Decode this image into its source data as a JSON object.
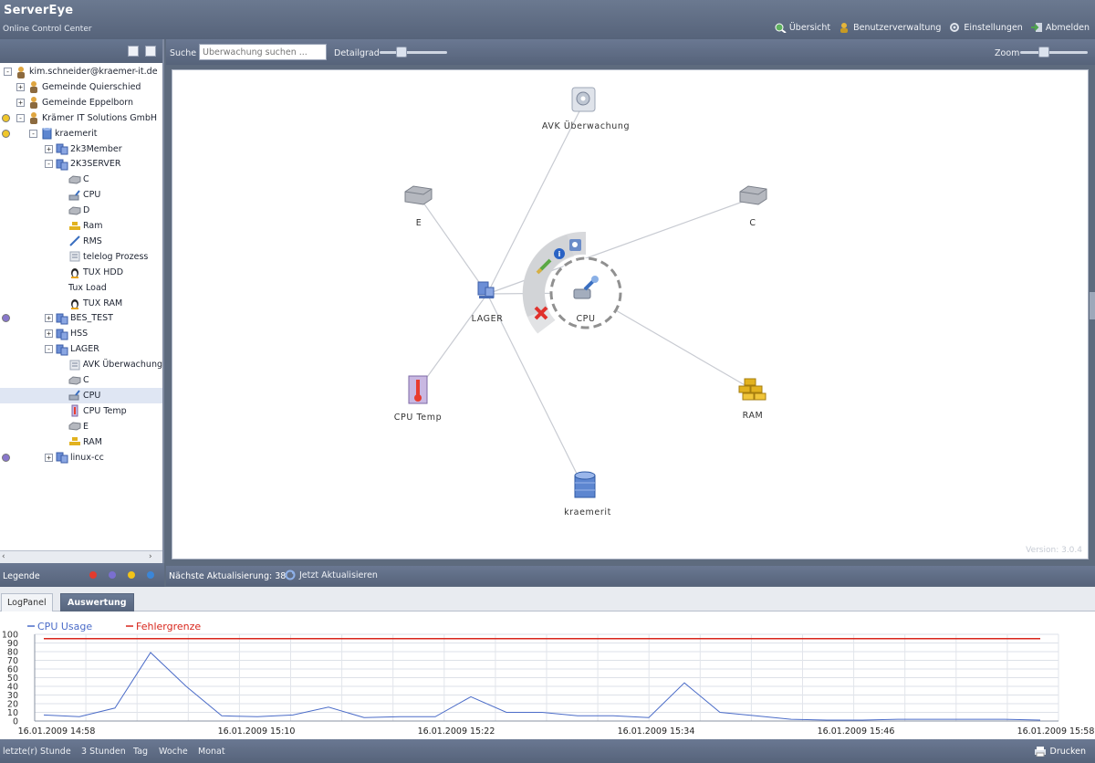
{
  "app": {
    "title": "ServerEye",
    "subtitle": "Online Control Center"
  },
  "top_nav": [
    {
      "label": "Übersicht",
      "icon": "overview-icon"
    },
    {
      "label": "Benutzerverwaltung",
      "icon": "user-management-icon"
    },
    {
      "label": "Einstellungen",
      "icon": "settings-icon"
    },
    {
      "label": "Abmelden",
      "icon": "logout-icon"
    }
  ],
  "tree": {
    "rows": [
      {
        "label": "kim.schneider@kraemer-it.de",
        "icon": "user-icon",
        "expander": "-",
        "indent": 0
      },
      {
        "label": "Gemeinde Quierschied",
        "icon": "user-icon",
        "expander": "+",
        "indent": 1
      },
      {
        "label": "Gemeinde Eppelborn",
        "icon": "user-icon",
        "expander": "+",
        "indent": 1
      },
      {
        "label": "Krämer IT Solutions GmbH",
        "icon": "user-icon",
        "expander": "-",
        "indent": 1,
        "status": "yellow"
      },
      {
        "label": "kraemerit",
        "icon": "database-icon",
        "expander": "-",
        "indent": 2,
        "status": "yellow"
      },
      {
        "label": "2k3Member",
        "icon": "server-group-icon",
        "expander": "+",
        "indent": 3
      },
      {
        "label": "2K3SERVER",
        "icon": "server-group-icon",
        "expander": "-",
        "indent": 3
      },
      {
        "label": "C",
        "icon": "drive-icon",
        "indent": 4
      },
      {
        "label": "CPU",
        "icon": "cpu-icon",
        "indent": 4
      },
      {
        "label": "D",
        "icon": "drive-icon",
        "indent": 4
      },
      {
        "label": "Ram",
        "icon": "ram-icon",
        "indent": 4
      },
      {
        "label": "RMS",
        "icon": "pen-icon",
        "indent": 4
      },
      {
        "label": "telelog Prozess",
        "icon": "process-icon",
        "indent": 4
      },
      {
        "label": "TUX HDD",
        "icon": "tux-icon",
        "indent": 4
      },
      {
        "label": "Tux Load",
        "icon": "none",
        "indent": 4
      },
      {
        "label": "TUX RAM",
        "icon": "tux-icon",
        "indent": 4
      },
      {
        "label": "BES_TEST",
        "icon": "server-group-icon",
        "expander": "+",
        "indent": 3,
        "status": "purple"
      },
      {
        "label": "HSS",
        "icon": "server-group-icon",
        "expander": "+",
        "indent": 3
      },
      {
        "label": "LAGER",
        "icon": "server-group-icon",
        "expander": "-",
        "indent": 3
      },
      {
        "label": "AVK Überwachung",
        "icon": "process-icon",
        "indent": 4
      },
      {
        "label": "C",
        "icon": "drive-icon",
        "indent": 4
      },
      {
        "label": "CPU",
        "icon": "cpu-icon",
        "indent": 4,
        "selected": true
      },
      {
        "label": "CPU Temp",
        "icon": "thermometer-icon",
        "indent": 4
      },
      {
        "label": "E",
        "icon": "drive-icon",
        "indent": 4
      },
      {
        "label": "RAM",
        "icon": "ram-icon",
        "indent": 4
      },
      {
        "label": "linux-cc",
        "icon": "server-group-icon",
        "expander": "+",
        "indent": 3,
        "status": "purple"
      }
    ]
  },
  "legend": {
    "label": "Legende",
    "colors": [
      "#e23b2e",
      "#7a6fd0",
      "#f2c318",
      "#3b86d8"
    ]
  },
  "toolbar": {
    "search_label": "Suche",
    "search_placeholder": "Überwachung suchen ...",
    "detail_label": "Detailgrad",
    "zoom_label": "Zoom"
  },
  "graph": {
    "center": {
      "label": "LAGER"
    },
    "selected": {
      "label": "CPU"
    },
    "nodes": [
      {
        "id": "avk",
        "label": "AVK Überwachung",
        "icon": "process-icon"
      },
      {
        "id": "e",
        "label": "E",
        "icon": "drive-icon"
      },
      {
        "id": "c",
        "label": "C",
        "icon": "drive-icon"
      },
      {
        "id": "cputemp",
        "label": "CPU Temp",
        "icon": "thermometer-icon"
      },
      {
        "id": "ram",
        "label": "RAM",
        "icon": "ram-icon"
      },
      {
        "id": "kraemerit",
        "label": "kraemerit",
        "icon": "database-icon"
      }
    ],
    "version": "Version: 3.0.4"
  },
  "status": {
    "next_update": "Nächste Aktualisierung: 38",
    "refresh_label": "Jetzt Aktualisieren"
  },
  "bottom_tabs": [
    {
      "label": "LogPanel",
      "active": false
    },
    {
      "label": "Auswertung",
      "active": true
    }
  ],
  "chart_data": {
    "type": "line",
    "y_ticks": [
      "100",
      "90",
      "80",
      "70",
      "60",
      "50",
      "40",
      "30",
      "20",
      "10",
      "0"
    ],
    "ylim": [
      0,
      100
    ],
    "x_labels": [
      "16.01.2009 14:58",
      "16.01.2009 15:10",
      "16.01.2009 15:22",
      "16.01.2009 15:34",
      "16.01.2009 15:46",
      "16.01.2009 15:58"
    ],
    "series": [
      {
        "name": "CPU Usage",
        "color": "#4b6cc8",
        "values": [
          7,
          5,
          15,
          79,
          40,
          6,
          5,
          7,
          16,
          4,
          5,
          5,
          28,
          10,
          10,
          6,
          6,
          4,
          44,
          10,
          6,
          2,
          1,
          1,
          2,
          2,
          2,
          2,
          1
        ]
      },
      {
        "name": "Fehlergrenze",
        "color": "#d8261c",
        "values": [
          95,
          95,
          95,
          95,
          95,
          95,
          95,
          95,
          95,
          95,
          95,
          95,
          95,
          95,
          95,
          95,
          95,
          95,
          95,
          95,
          95,
          95,
          95,
          95,
          95,
          95,
          95,
          95,
          95
        ]
      }
    ]
  },
  "footer": {
    "ranges": [
      "letzte(r)",
      "Stunde",
      "3 Stunden",
      "Tag",
      "Woche",
      "Monat"
    ],
    "print_label": "Drucken"
  }
}
